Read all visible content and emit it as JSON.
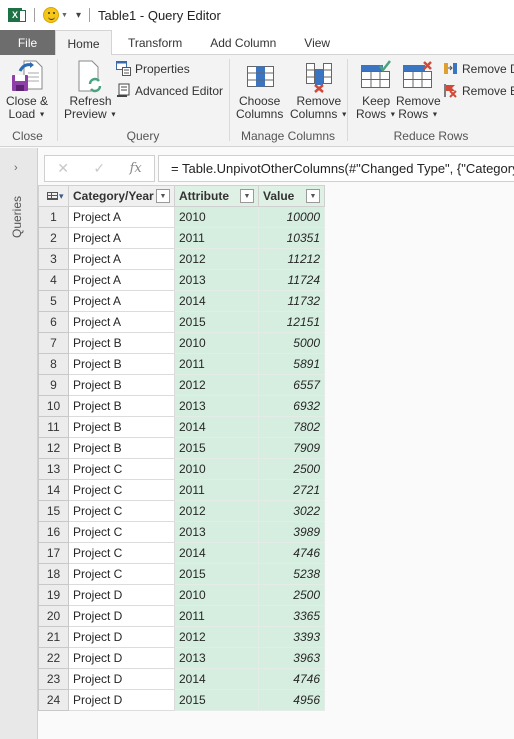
{
  "titlebar": {
    "app_icon": "excel-icon",
    "qat_icon": "smiley-feedback-icon",
    "title": "Table1 - Query Editor"
  },
  "tabs": [
    {
      "label": "File"
    },
    {
      "label": "Home",
      "active": true
    },
    {
      "label": "Transform"
    },
    {
      "label": "Add Column"
    },
    {
      "label": "View"
    }
  ],
  "ribbon": {
    "groups": {
      "close": {
        "label": "Close",
        "close_load": {
          "line1": "Close &",
          "line2": "Load"
        }
      },
      "query": {
        "label": "Query",
        "refresh_preview": {
          "line1": "Refresh",
          "line2": "Preview"
        },
        "properties": "Properties",
        "advanced_editor": "Advanced Editor"
      },
      "manage_columns": {
        "label": "Manage Columns",
        "choose_columns": {
          "line1": "Choose",
          "line2": "Columns"
        },
        "remove_columns": {
          "line1": "Remove",
          "line2": "Columns"
        }
      },
      "reduce_rows": {
        "label": "Reduce Rows",
        "keep_rows": {
          "line1": "Keep",
          "line2": "Rows"
        },
        "remove_rows": {
          "line1": "Remove",
          "line2": "Rows"
        },
        "remove_duplicates": "Remove Duplicates",
        "remove_errors": "Remove Errors"
      }
    }
  },
  "queries_pane": {
    "label": "Queries"
  },
  "formula_bar": {
    "cancel": "✕",
    "confirm": "✓",
    "fx": "fx",
    "formula": "= Table.UnpivotOtherColumns(#\"Changed Type\", {\"Category/Year\"}, \"Attribute\", \"Value\")"
  },
  "grid": {
    "columns": [
      "Category/Year",
      "Attribute",
      "Value"
    ],
    "rows": [
      [
        "Project A",
        "2010",
        "10000"
      ],
      [
        "Project A",
        "2011",
        "10351"
      ],
      [
        "Project A",
        "2012",
        "11212"
      ],
      [
        "Project A",
        "2013",
        "11724"
      ],
      [
        "Project A",
        "2014",
        "11732"
      ],
      [
        "Project A",
        "2015",
        "12151"
      ],
      [
        "Project B",
        "2010",
        "5000"
      ],
      [
        "Project B",
        "2011",
        "5891"
      ],
      [
        "Project B",
        "2012",
        "6557"
      ],
      [
        "Project B",
        "2013",
        "6932"
      ],
      [
        "Project B",
        "2014",
        "7802"
      ],
      [
        "Project B",
        "2015",
        "7909"
      ],
      [
        "Project C",
        "2010",
        "2500"
      ],
      [
        "Project C",
        "2011",
        "2721"
      ],
      [
        "Project C",
        "2012",
        "3022"
      ],
      [
        "Project C",
        "2013",
        "3989"
      ],
      [
        "Project C",
        "2014",
        "4746"
      ],
      [
        "Project C",
        "2015",
        "5238"
      ],
      [
        "Project D",
        "2010",
        "2500"
      ],
      [
        "Project D",
        "2011",
        "3365"
      ],
      [
        "Project D",
        "2012",
        "3393"
      ],
      [
        "Project D",
        "2013",
        "3963"
      ],
      [
        "Project D",
        "2014",
        "4746"
      ],
      [
        "Project D",
        "2015",
        "4956"
      ]
    ]
  }
}
